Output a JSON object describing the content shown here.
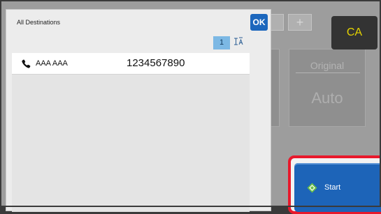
{
  "dialog": {
    "title": "All Destinations",
    "ok_label": "OK",
    "count": "1",
    "sort_icon": "sort-icon"
  },
  "destinations": [
    {
      "type": "phone-icon",
      "name": "AAA AAA",
      "number": "1234567890"
    }
  ],
  "background": {
    "tab_plus": "+",
    "panel_label": "Original",
    "panel_value": "Auto"
  },
  "controls": {
    "ca_label": "CA",
    "start_label": "Start"
  },
  "colors": {
    "ok": "#1c67bd",
    "start": "#1d64b8",
    "highlight": "#e8192c",
    "ca_text": "#e6d400",
    "count_badge": "#7cb8e4"
  }
}
